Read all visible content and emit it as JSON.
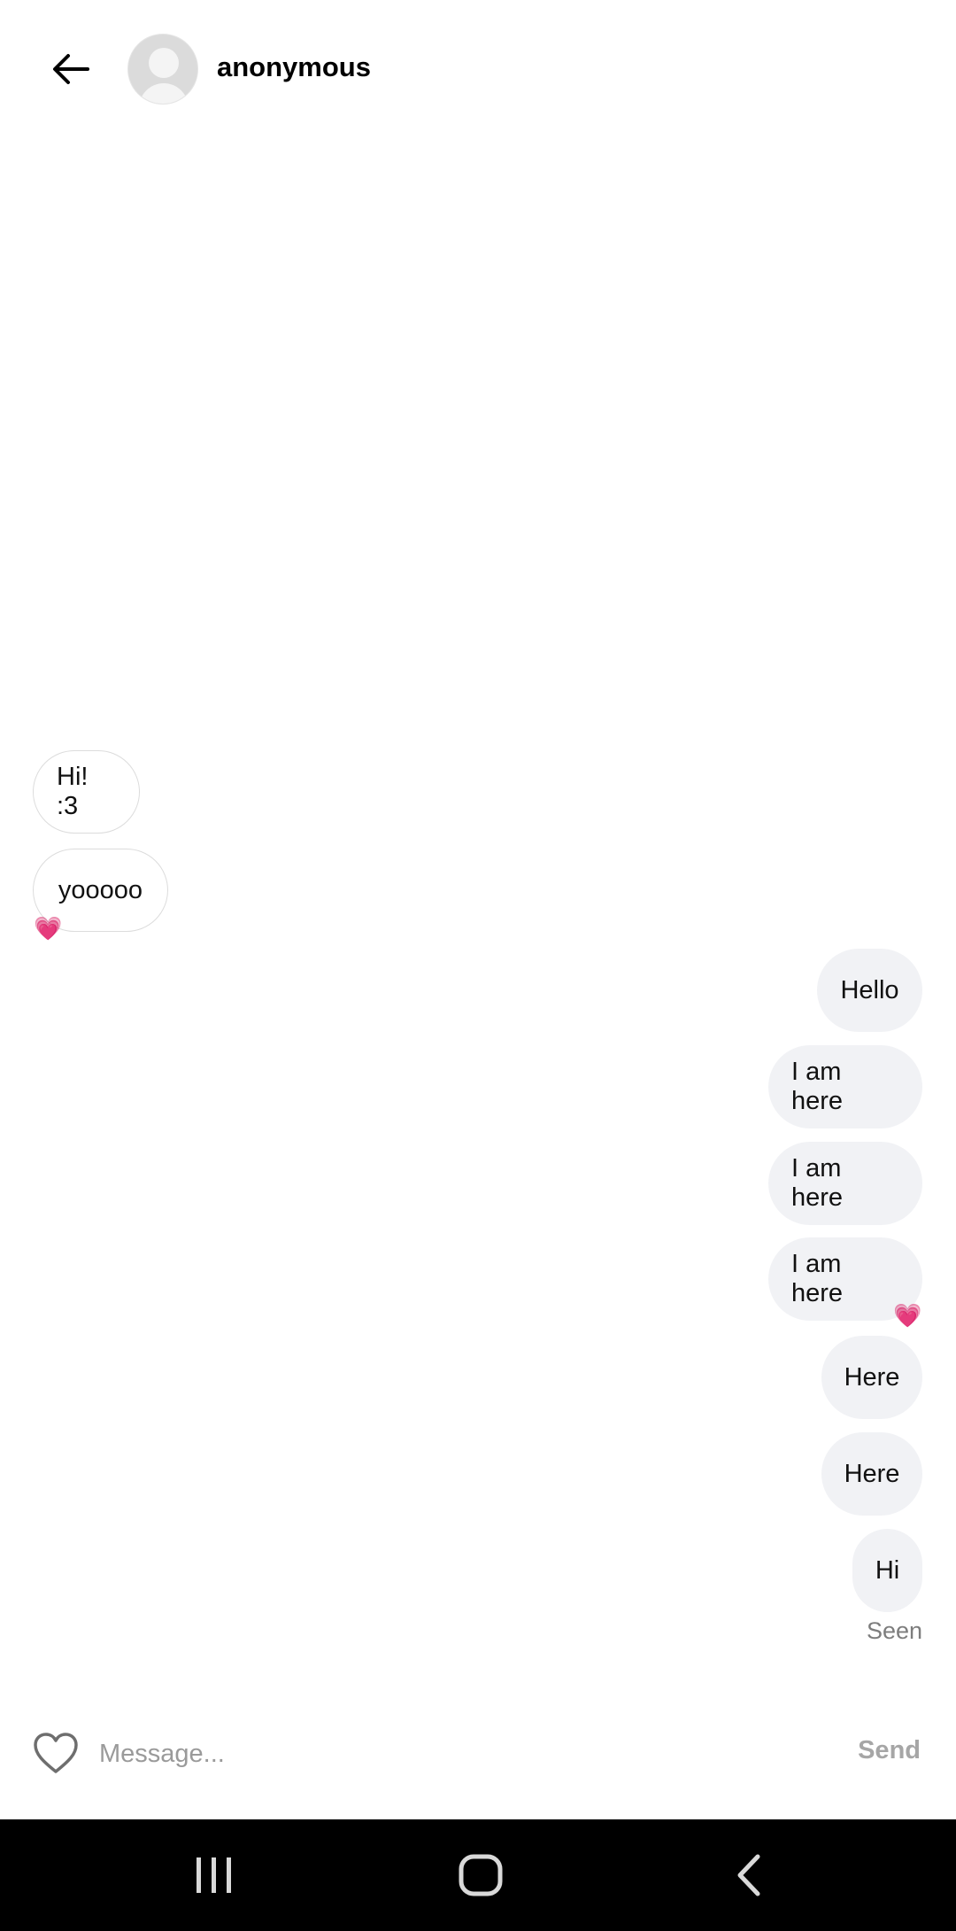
{
  "header": {
    "contact_name": "anonymous"
  },
  "messages": [
    {
      "text": "Hi! :3",
      "direction": "in",
      "reaction": ""
    },
    {
      "text": "yooooo",
      "direction": "in",
      "reaction": "💗"
    },
    {
      "text": "Hello",
      "direction": "out",
      "reaction": ""
    },
    {
      "text": "I am here",
      "direction": "out",
      "reaction": ""
    },
    {
      "text": "I am here",
      "direction": "out",
      "reaction": ""
    },
    {
      "text": "I am here",
      "direction": "out",
      "reaction": "💗"
    },
    {
      "text": "Here",
      "direction": "out",
      "reaction": ""
    },
    {
      "text": "Here",
      "direction": "out",
      "reaction": ""
    },
    {
      "text": "Hi",
      "direction": "out",
      "reaction": ""
    }
  ],
  "seen_label": "Seen",
  "composer": {
    "placeholder": "Message...",
    "send_label": "Send"
  },
  "icons": {
    "back": "arrow-left-icon",
    "like": "heart-outline-icon",
    "recents": "recent-apps-icon",
    "home": "home-icon",
    "system_back": "chevron-left-icon"
  },
  "colors": {
    "incoming_bubble_border": "#dcdcdc",
    "outgoing_bubble_bg": "#f1f2f5",
    "reaction_heart": "#ff2e9a",
    "send_disabled": "#a6a6a6",
    "nav_bar_bg": "#000000"
  }
}
